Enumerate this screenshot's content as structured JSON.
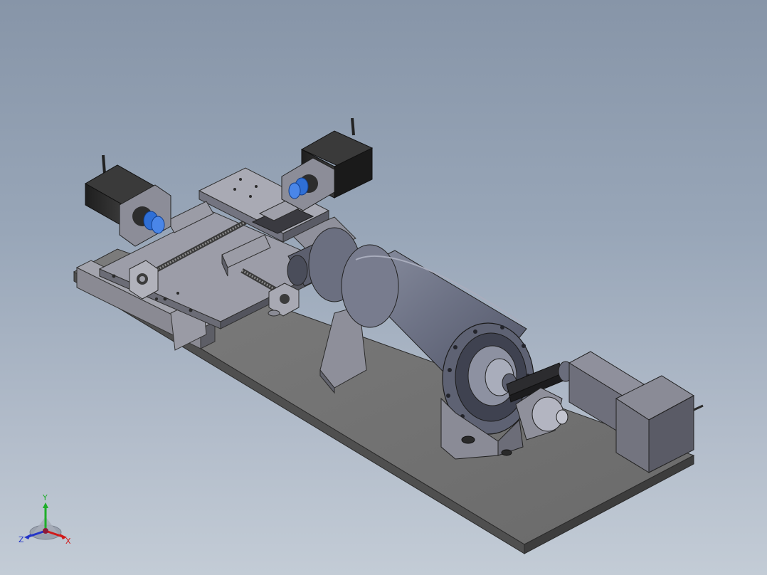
{
  "view_triad": {
    "x_label": "X",
    "y_label": "Y",
    "z_label": "Z",
    "x_color": "#d01a1a",
    "y_color": "#1fae2a",
    "z_color": "#2435c8"
  },
  "model": {
    "parts": [
      "base-plate",
      "xy-stage",
      "stepper-motor-left",
      "stepper-motor-right",
      "lead-screw",
      "spindle-housing",
      "spindle-support",
      "belt-drive",
      "drive-motor"
    ]
  }
}
